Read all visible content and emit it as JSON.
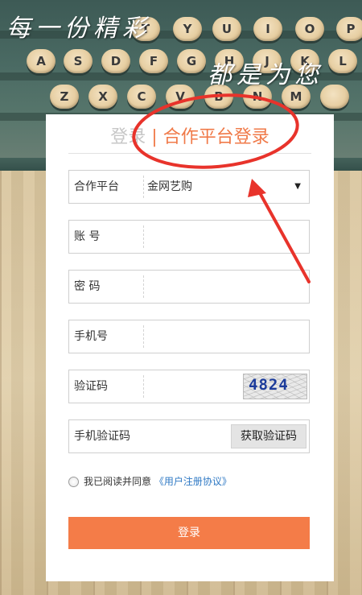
{
  "background": {
    "handwriting_left": "每一份精彩",
    "handwriting_right": "都是为您",
    "keys_row1": [
      "T",
      "Y",
      "U",
      "I",
      "O",
      "P"
    ],
    "keys_row2": [
      "A",
      "S",
      "D",
      "F",
      "G",
      "H",
      "J",
      "K",
      "L"
    ],
    "keys_row3": [
      "Z",
      "X",
      "C",
      "V",
      "B",
      "N",
      "M"
    ]
  },
  "tabs": {
    "login": "登录",
    "separator": "|",
    "partner_login": "合作平台登录"
  },
  "form": {
    "platform": {
      "label": "合作平台",
      "value": "金网艺购",
      "caret": "▼"
    },
    "account": {
      "label": "账 号",
      "value": ""
    },
    "password": {
      "label": "密 码",
      "value": ""
    },
    "phone": {
      "label": "手机号",
      "value": ""
    },
    "captcha": {
      "label": "验证码",
      "image_text": "4824"
    },
    "sms": {
      "label": "手机验证码",
      "button": "获取验证码"
    }
  },
  "agreement": {
    "text": "我已阅读并同意",
    "link": "《用户注册协议》"
  },
  "submit_label": "登录",
  "colors": {
    "accent": "#f47c48",
    "annotation": "#e8332b",
    "link": "#2f79c4"
  }
}
